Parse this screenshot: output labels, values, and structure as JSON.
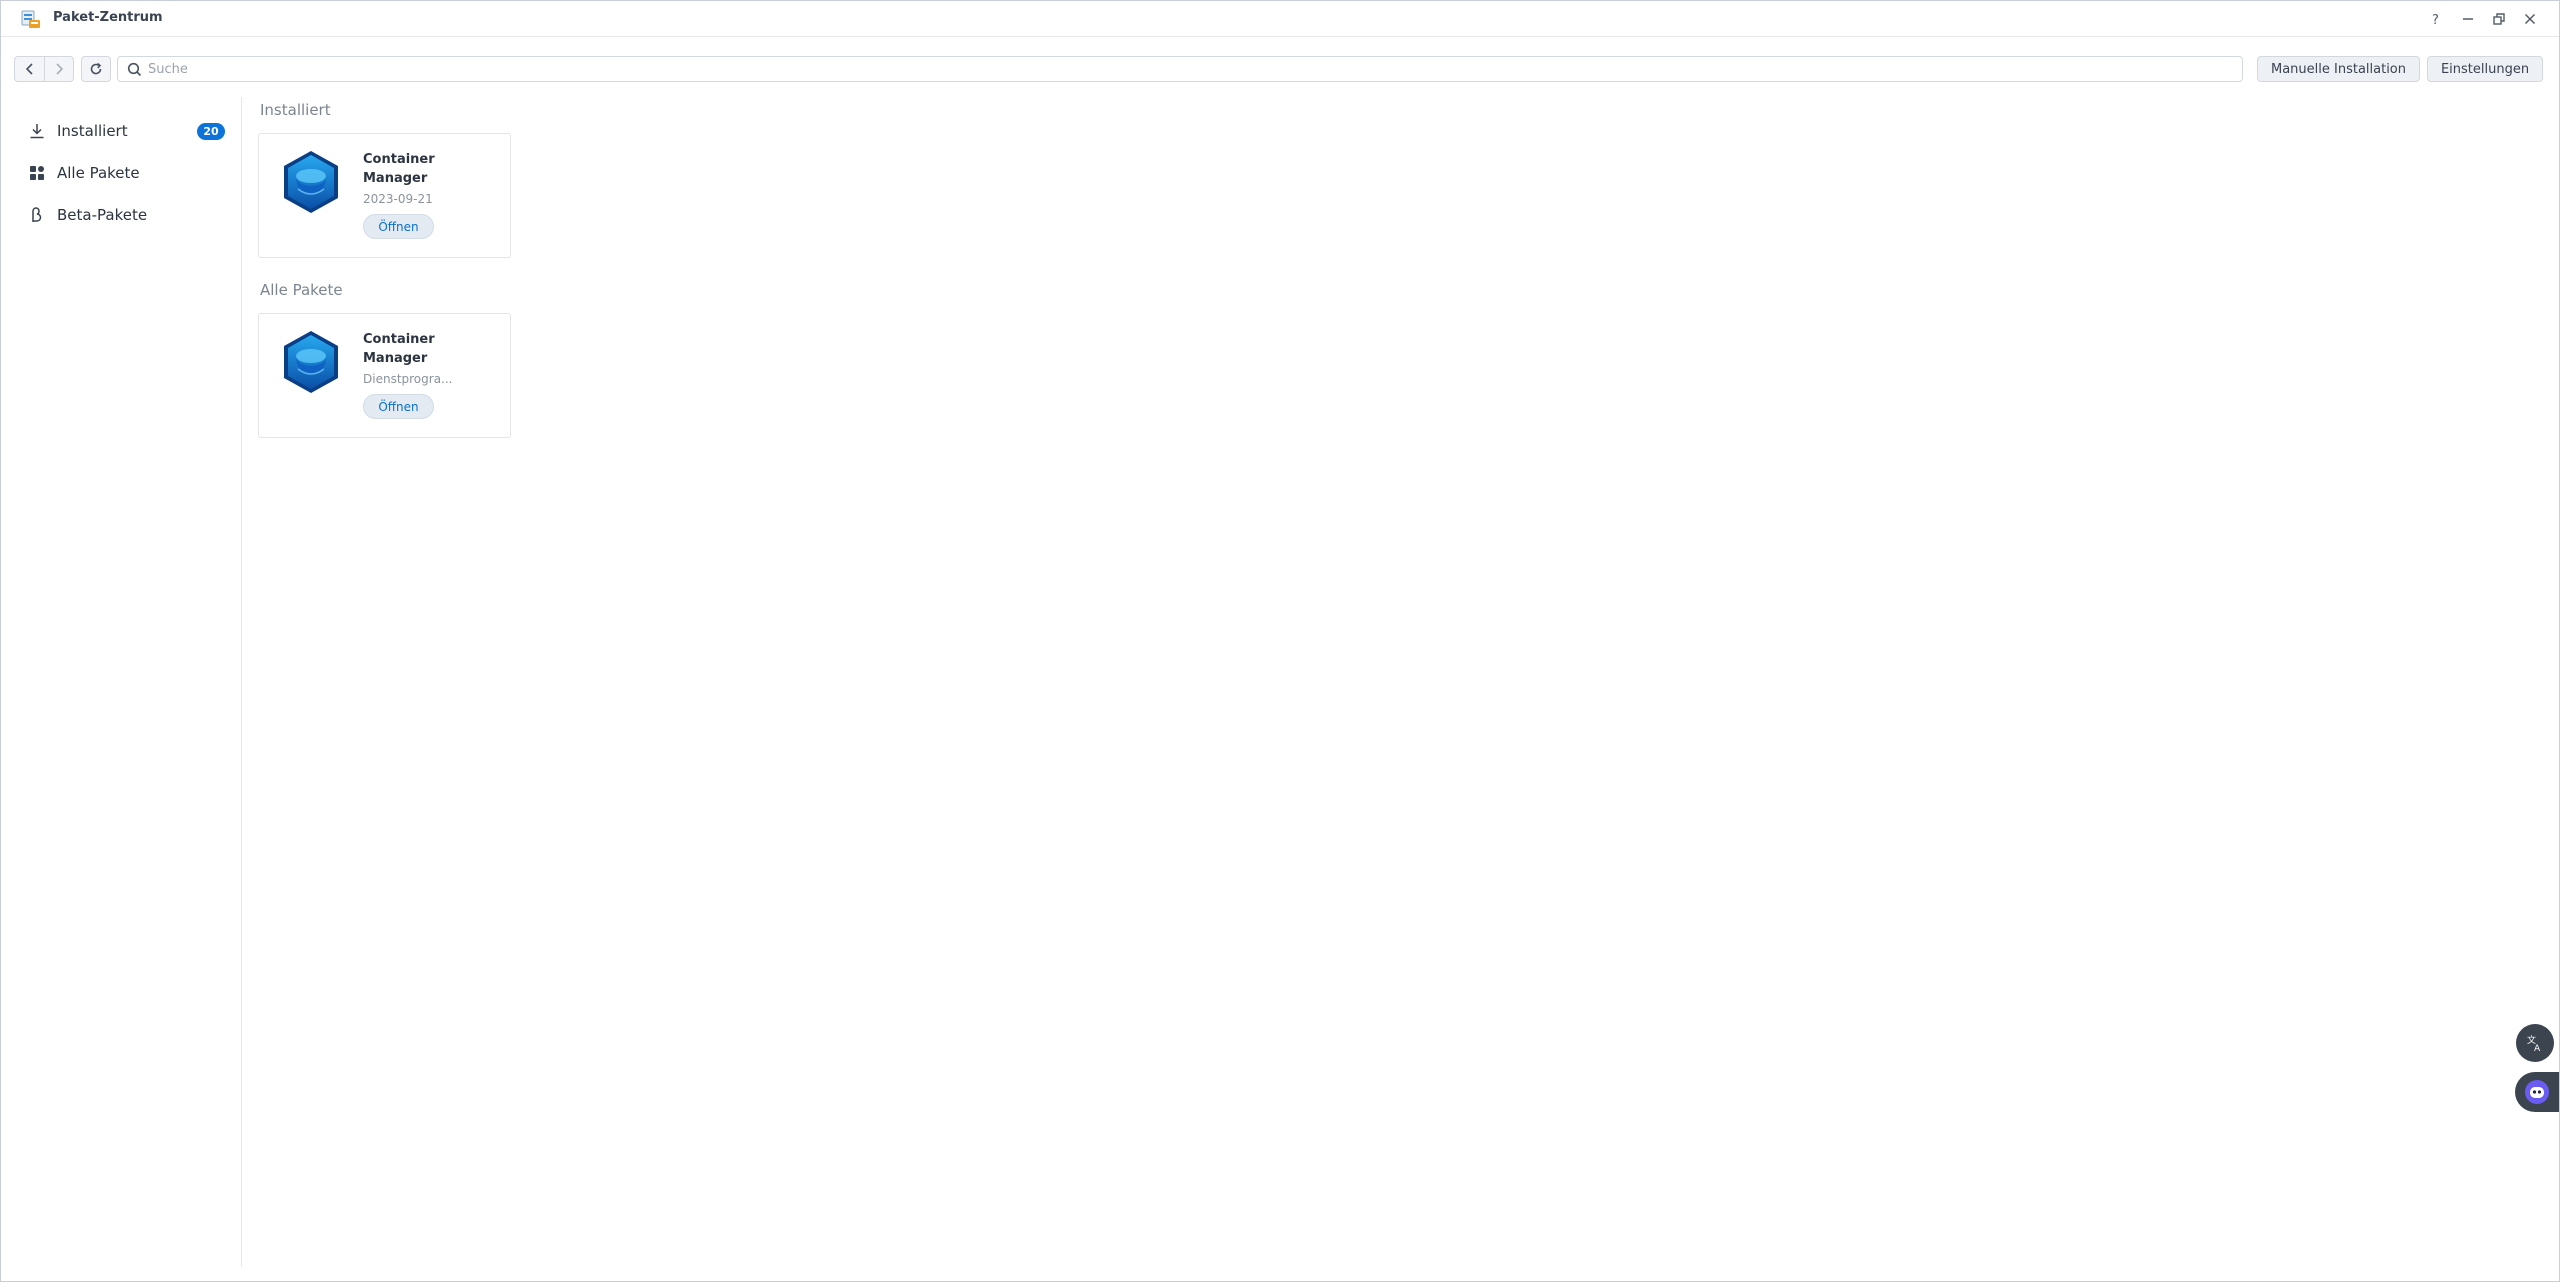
{
  "window": {
    "title": "Paket-Zentrum"
  },
  "toolbar": {
    "search_placeholder": "Suche",
    "manual_install_label": "Manuelle Installation",
    "settings_label": "Einstellungen"
  },
  "sidebar": {
    "items": [
      {
        "label": "Installiert",
        "icon": "download-icon",
        "badge": "20"
      },
      {
        "label": "Alle Pakete",
        "icon": "grid-icon"
      },
      {
        "label": "Beta-Pakete",
        "icon": "beta-icon"
      }
    ]
  },
  "sections": [
    {
      "title": "Installiert",
      "cards": [
        {
          "name": "Container Manager",
          "meta": "2023-09-21",
          "button": "Öffnen",
          "icon": "container-manager-icon"
        }
      ]
    },
    {
      "title": "Alle Pakete",
      "cards": [
        {
          "name": "Container Manager",
          "meta": "Dienstprogra...",
          "button": "Öffnen",
          "icon": "container-manager-icon"
        }
      ]
    }
  ],
  "colors": {
    "accent": "#0b73d9",
    "button_text": "#0b6fcf",
    "section_title": "#7b8590"
  }
}
